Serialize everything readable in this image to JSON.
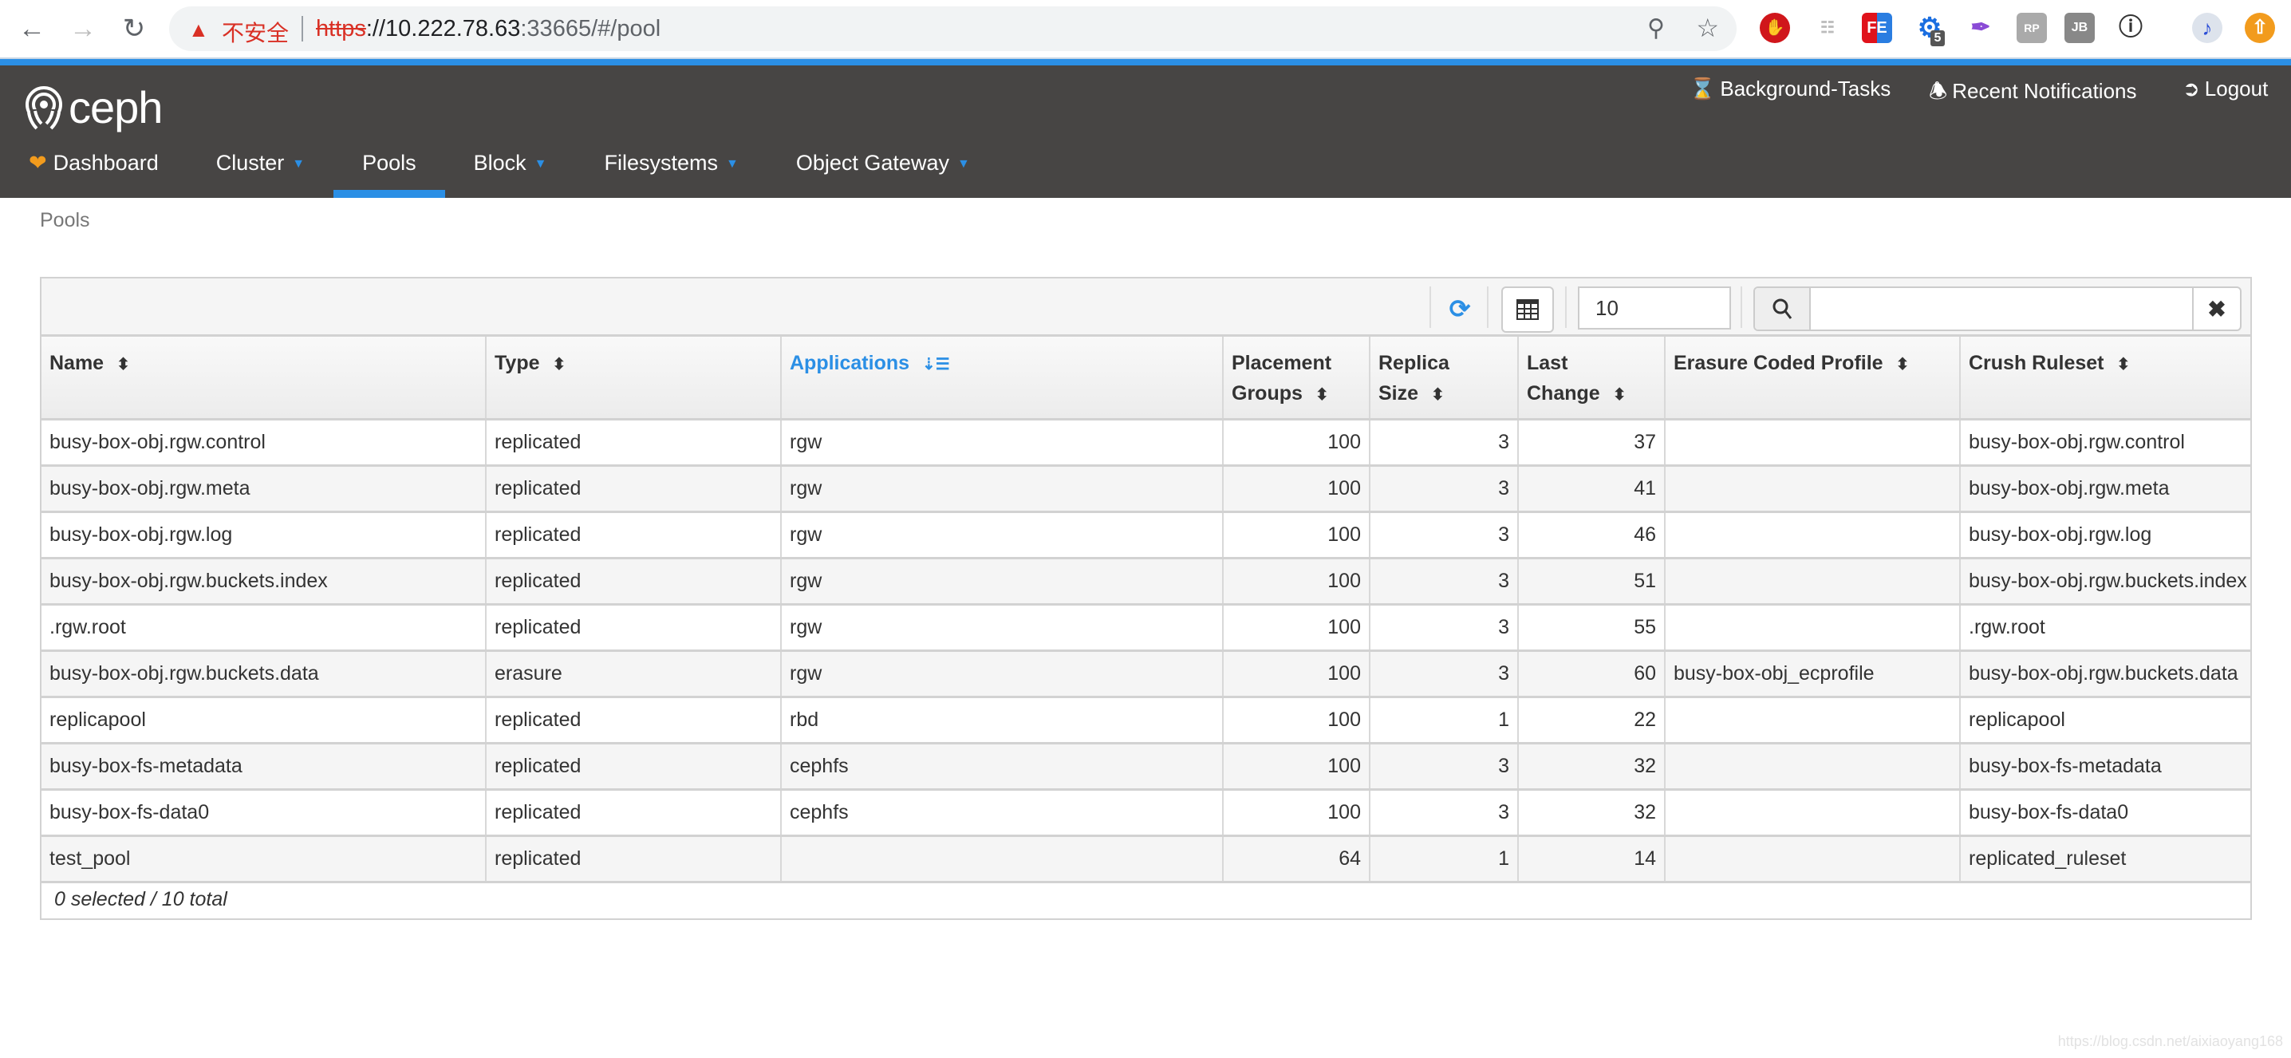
{
  "browser": {
    "security_label": "不安全",
    "url_scheme": "https",
    "url_host": "://10.222.78.63",
    "url_rest": ":33665/#/pool",
    "extension_badge": "5"
  },
  "app": {
    "logo_text": "ceph",
    "utility": {
      "background_tasks": "Background-Tasks",
      "notifications": "Recent Notifications",
      "logout": "Logout"
    },
    "menu": [
      {
        "label": "Dashboard",
        "dropdown": false,
        "active": false
      },
      {
        "label": "Cluster",
        "dropdown": true,
        "active": false
      },
      {
        "label": "Pools",
        "dropdown": false,
        "active": true
      },
      {
        "label": "Block",
        "dropdown": true,
        "active": false
      },
      {
        "label": "Filesystems",
        "dropdown": true,
        "active": false
      },
      {
        "label": "Object Gateway",
        "dropdown": true,
        "active": false
      }
    ],
    "accent_color": "#2b8fe5",
    "navbar_color": "#474544"
  },
  "breadcrumb": "Pools",
  "table": {
    "page_size": "10",
    "search_value": "",
    "columns": [
      {
        "label": "Name",
        "sorted": false
      },
      {
        "label": "Type",
        "sorted": false
      },
      {
        "label": "Applications",
        "sorted": true
      },
      {
        "label": "Placement Groups",
        "sorted": false
      },
      {
        "label": "Replica Size",
        "sorted": false
      },
      {
        "label": "Last Change",
        "sorted": false
      },
      {
        "label": "Erasure Coded Profile",
        "sorted": false
      },
      {
        "label": "Crush Ruleset",
        "sorted": false
      }
    ],
    "rows": [
      [
        "busy-box-obj.rgw.control",
        "replicated",
        "rgw",
        "100",
        "3",
        "37",
        "",
        "busy-box-obj.rgw.control"
      ],
      [
        "busy-box-obj.rgw.meta",
        "replicated",
        "rgw",
        "100",
        "3",
        "41",
        "",
        "busy-box-obj.rgw.meta"
      ],
      [
        "busy-box-obj.rgw.log",
        "replicated",
        "rgw",
        "100",
        "3",
        "46",
        "",
        "busy-box-obj.rgw.log"
      ],
      [
        "busy-box-obj.rgw.buckets.index",
        "replicated",
        "rgw",
        "100",
        "3",
        "51",
        "",
        "busy-box-obj.rgw.buckets.index"
      ],
      [
        ".rgw.root",
        "replicated",
        "rgw",
        "100",
        "3",
        "55",
        "",
        ".rgw.root"
      ],
      [
        "busy-box-obj.rgw.buckets.data",
        "erasure",
        "rgw",
        "100",
        "3",
        "60",
        "busy-box-obj_ecprofile",
        "busy-box-obj.rgw.buckets.data"
      ],
      [
        "replicapool",
        "replicated",
        "rbd",
        "100",
        "1",
        "22",
        "",
        "replicapool"
      ],
      [
        "busy-box-fs-metadata",
        "replicated",
        "cephfs",
        "100",
        "3",
        "32",
        "",
        "busy-box-fs-metadata"
      ],
      [
        "busy-box-fs-data0",
        "replicated",
        "cephfs",
        "100",
        "3",
        "32",
        "",
        "busy-box-fs-data0"
      ],
      [
        "test_pool",
        "replicated",
        "",
        "64",
        "1",
        "14",
        "",
        "replicated_ruleset"
      ]
    ],
    "footer": "0 selected / 10 total"
  },
  "watermark": "https://blog.csdn.net/aixiaoyang168"
}
